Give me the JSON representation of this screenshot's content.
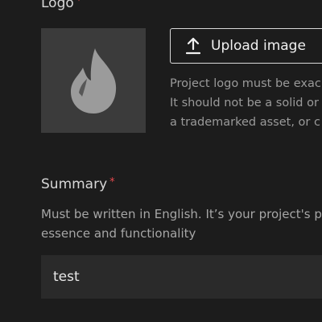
{
  "logo": {
    "label": "Logo",
    "required_marker": "*",
    "upload_label": "Upload image",
    "help_lines": [
      "Project logo must be exac",
      "It should not be a solid or",
      "a trademarked asset, or c"
    ]
  },
  "summary": {
    "label": "Summary",
    "required_marker": "*",
    "help_lines": [
      "Must be written in English. It’s your project's p",
      "essence and functionality"
    ],
    "value": "test"
  },
  "colors": {
    "background": "#1c1c1c",
    "required": "#e5484d",
    "preview_bg": "#3b3b3b",
    "icon": "#9b9b9b",
    "input_bg": "#2a2a2a"
  },
  "icons": {
    "logo_placeholder": "flame-icon",
    "upload": "upload-icon"
  }
}
